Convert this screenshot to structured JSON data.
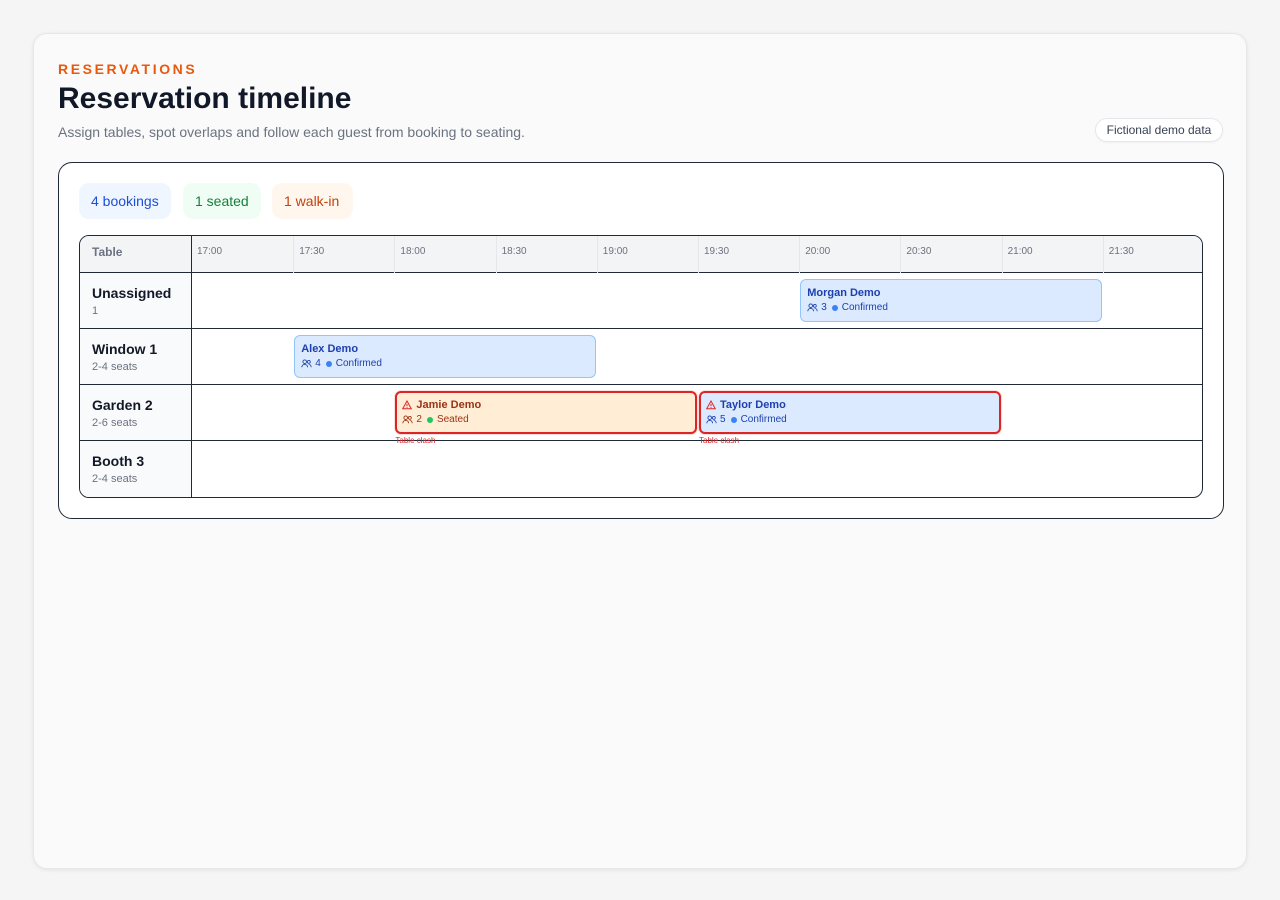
{
  "header": {
    "eyebrow": "RESERVATIONS",
    "title": "Reservation timeline",
    "subtitle": "Assign tables, spot overlaps and follow each guest from booking to seating.",
    "demo_badge": "Fictional demo data"
  },
  "summary": {
    "bookings": "4 bookings",
    "seated": "1 seated",
    "walkin": "1 walk-in"
  },
  "timeline": {
    "table_header": "Table",
    "times": [
      "17:00",
      "17:30",
      "18:00",
      "18:30",
      "19:00",
      "19:30",
      "20:00",
      "20:30",
      "21:00",
      "21:30"
    ],
    "rows": [
      {
        "name": "Unassigned",
        "sub": "1"
      },
      {
        "name": "Window 1",
        "sub": "2-4 seats"
      },
      {
        "name": "Garden 2",
        "sub": "2-6 seats"
      },
      {
        "name": "Booth 3",
        "sub": "2-4 seats"
      }
    ],
    "bookings": [
      {
        "guest": "Morgan Demo",
        "party": "3",
        "status": "Confirmed",
        "table": "Unassigned",
        "start": "20:00",
        "end": "21:30"
      },
      {
        "guest": "Alex Demo",
        "party": "4",
        "status": "Confirmed",
        "table": "Window 1",
        "start": "17:30",
        "end": "19:00"
      },
      {
        "guest": "Jamie Demo",
        "party": "2",
        "status": "Seated",
        "table": "Garden 2",
        "start": "18:00",
        "end": "19:30",
        "walk_in": true,
        "clash": true,
        "clash_label": "Table clash"
      },
      {
        "guest": "Taylor Demo",
        "party": "5",
        "status": "Confirmed",
        "table": "Garden 2",
        "start": "19:30",
        "end": "21:00",
        "clash": true,
        "clash_label": "Table clash"
      }
    ]
  },
  "colors": {
    "accent": "#ea580c",
    "confirmed": "#3b82f6",
    "seated": "#22c55e",
    "clash": "#dc2626"
  }
}
